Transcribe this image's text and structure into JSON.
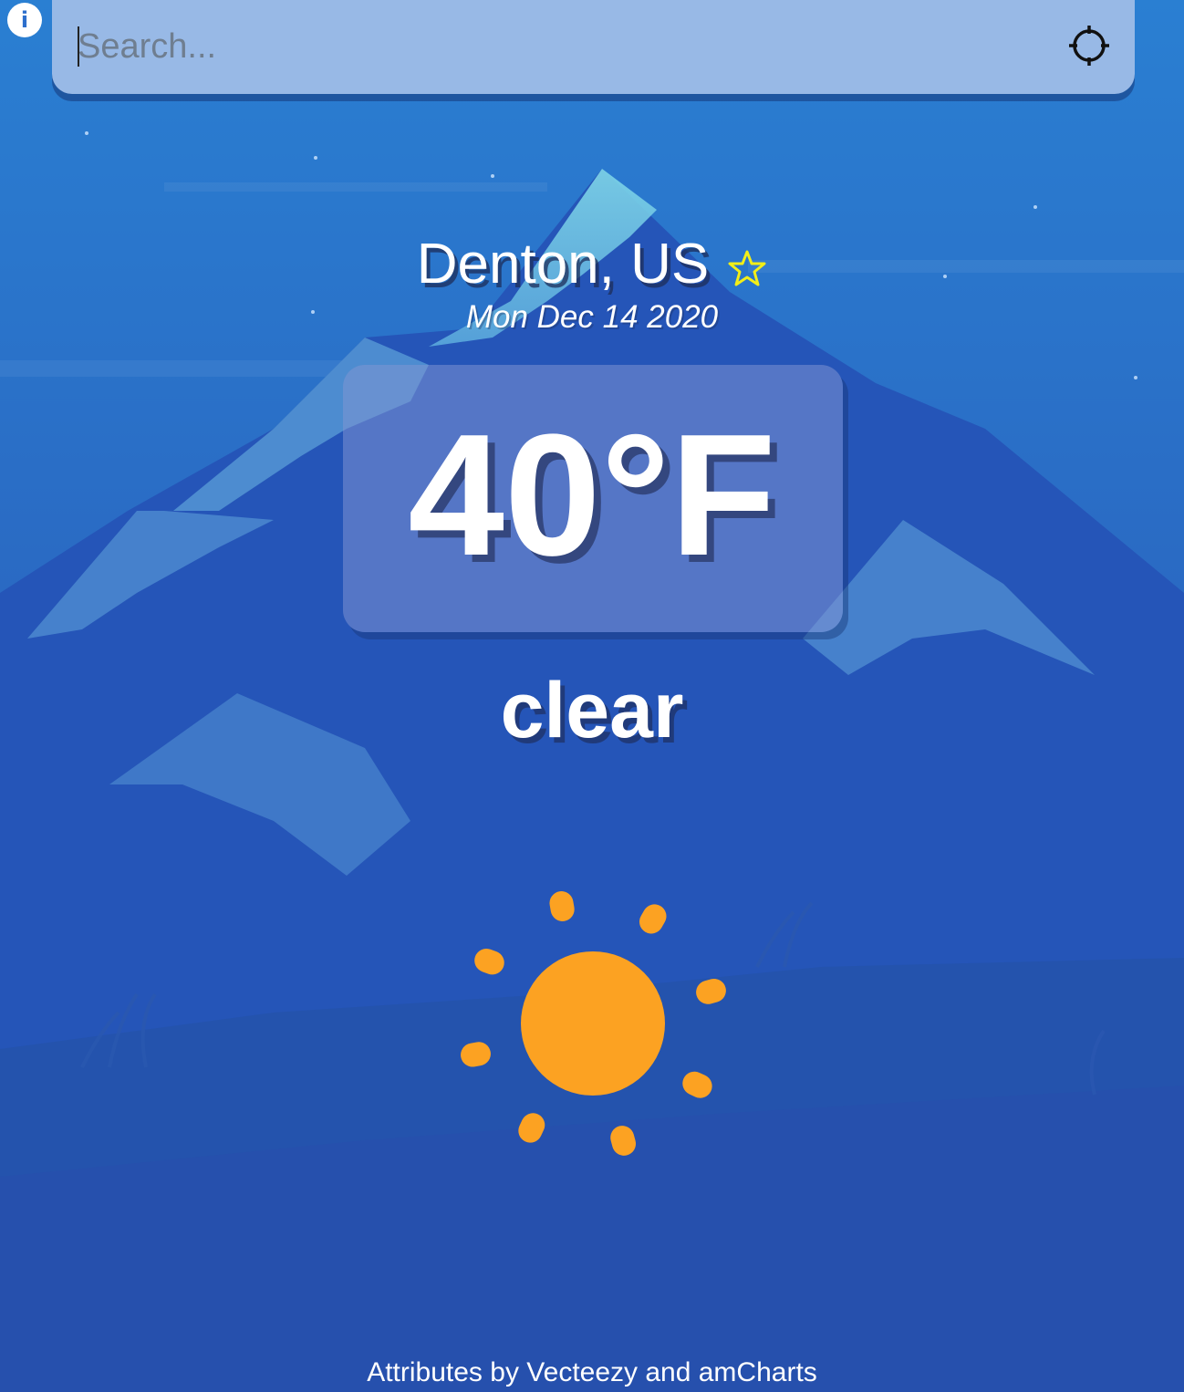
{
  "search": {
    "placeholder": "Search...",
    "value": ""
  },
  "location": {
    "city": "Denton, US",
    "date": "Mon Dec 14 2020",
    "favorite": false
  },
  "weather": {
    "temperature": "40°F",
    "condition": "clear",
    "icon": "sun-icon"
  },
  "footer": {
    "attribution": "Attributes by Vecteezy and amCharts"
  },
  "icons": {
    "info": "info-icon",
    "locate": "crosshair-icon",
    "favorite": "star-icon"
  },
  "colors": {
    "sky_top": "#2a7bcf",
    "sky_bottom": "#2957b0",
    "search_bar": "#98b9e6",
    "star": "#f2ee18",
    "sun": "#fca222",
    "text": "#ffffff"
  }
}
